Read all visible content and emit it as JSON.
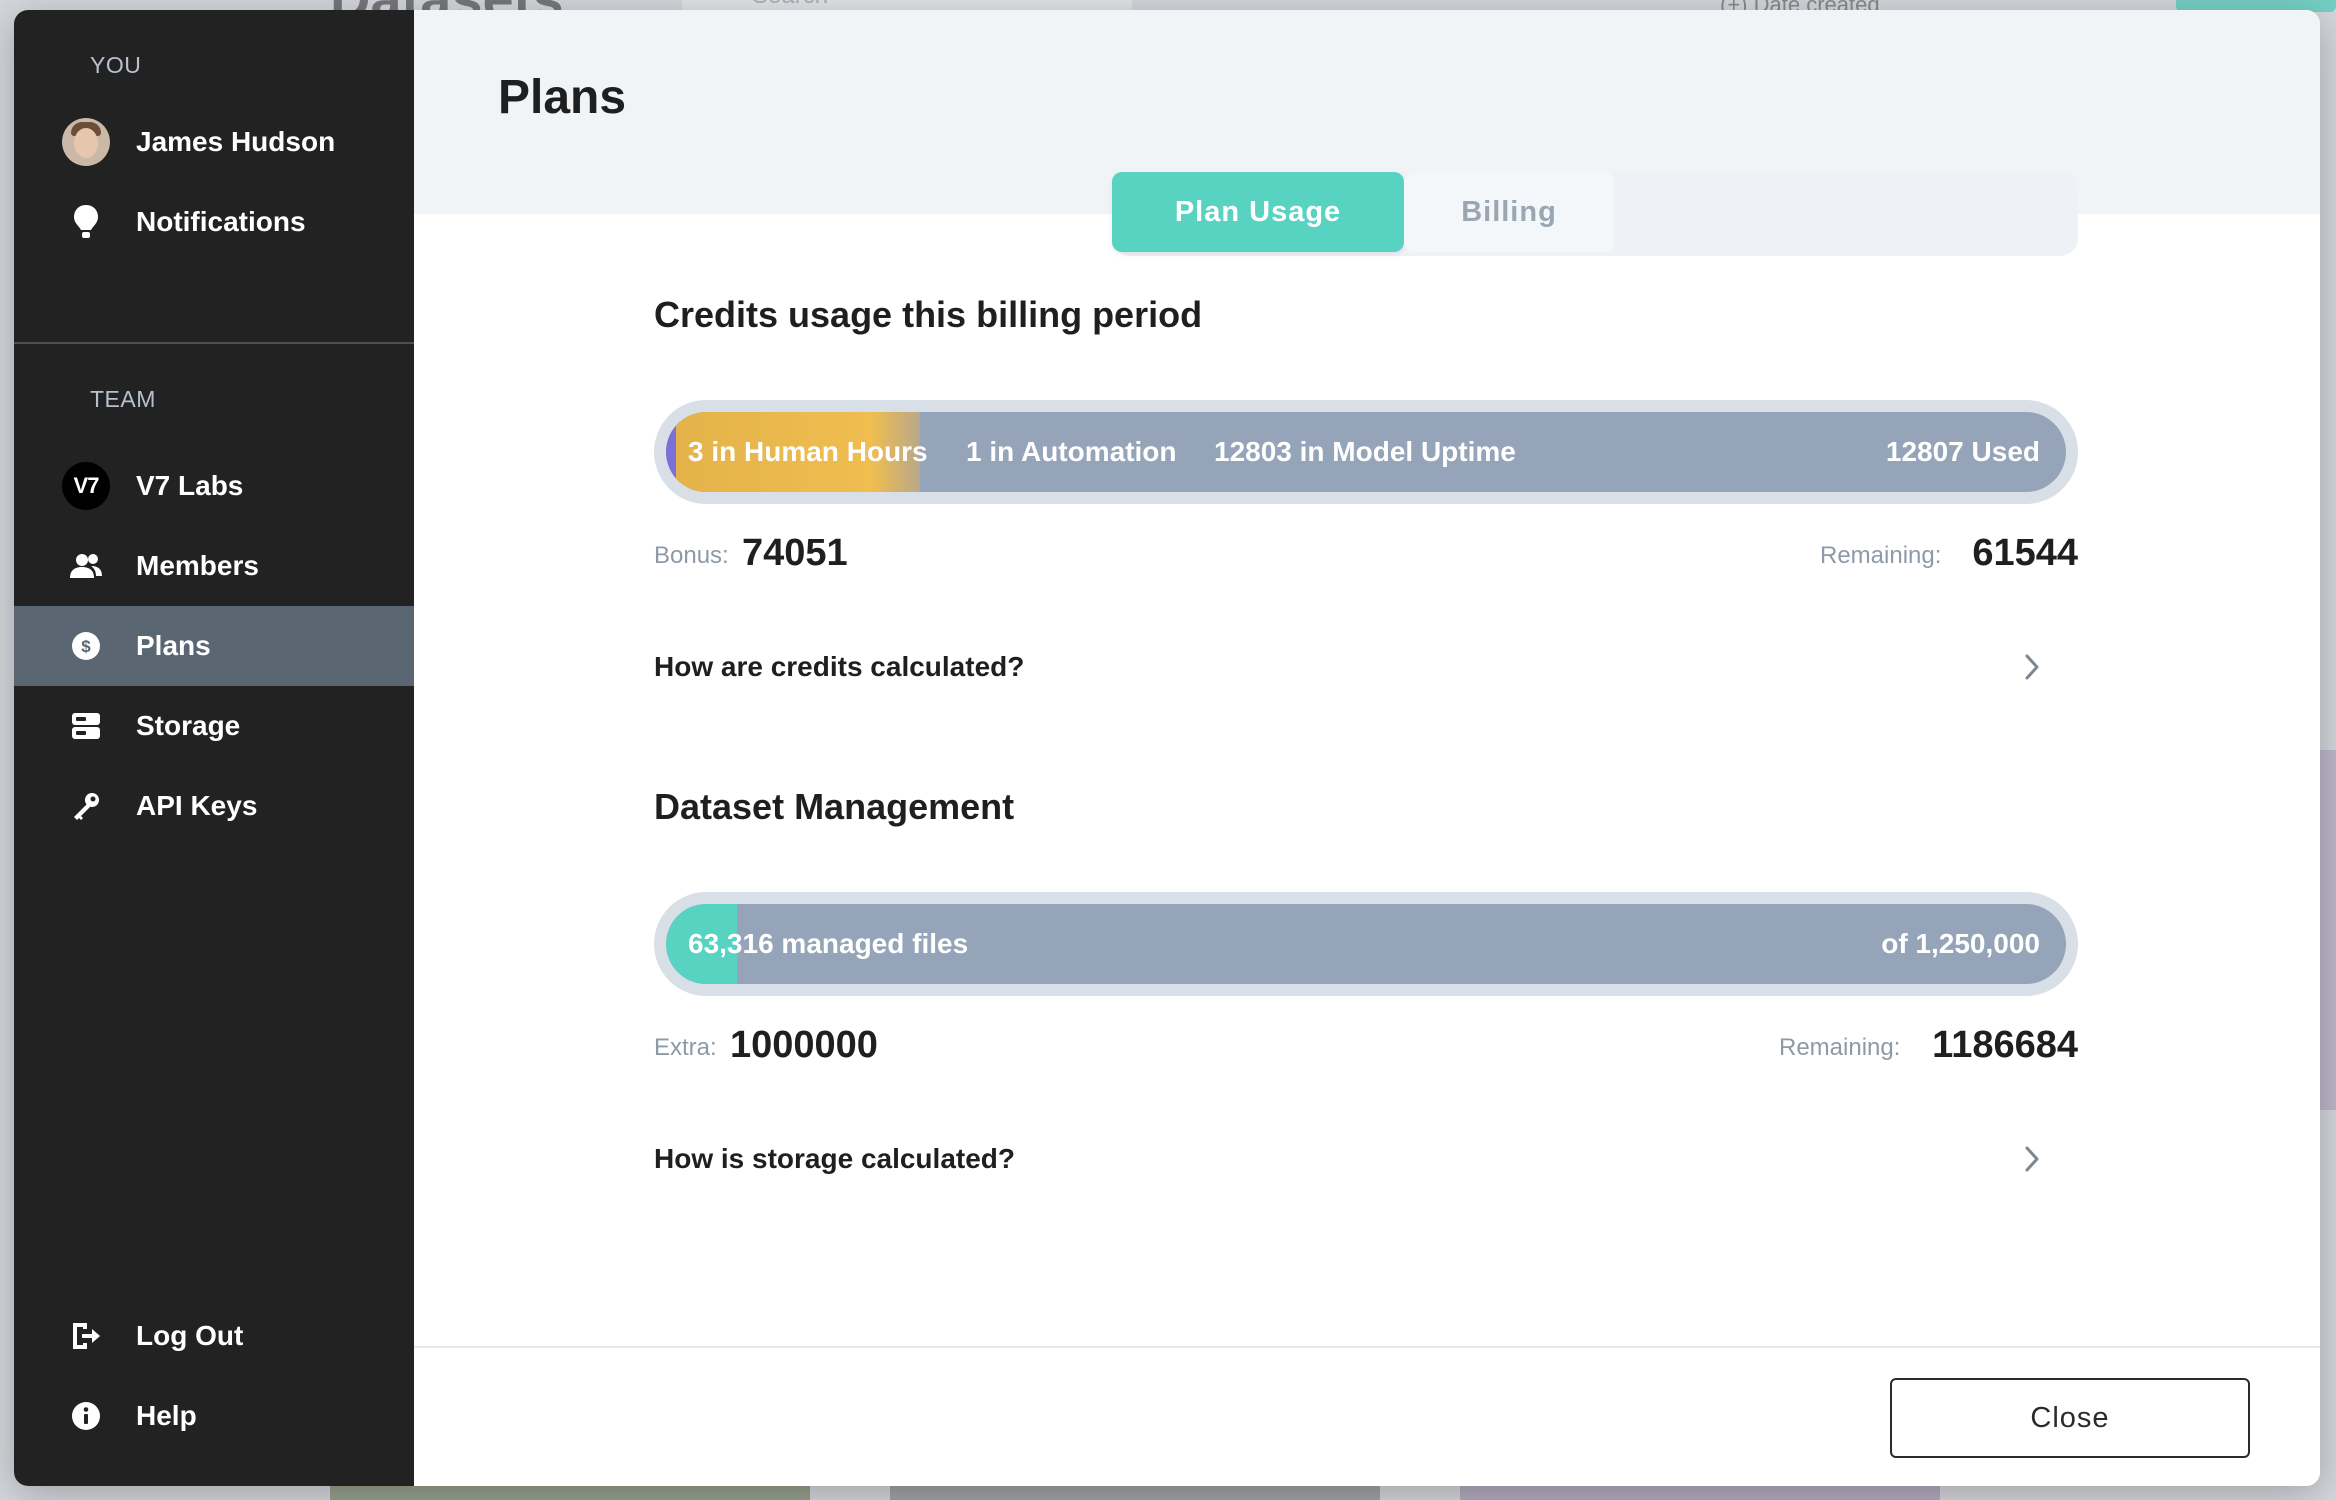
{
  "sidebar": {
    "you_label": "YOU",
    "team_label": "TEAM",
    "user": {
      "name": "James Hudson",
      "icon": "avatar"
    },
    "notifications": {
      "label": "Notifications",
      "icon": "lightbulb-icon"
    },
    "team_items": [
      {
        "label": "V7 Labs",
        "icon": "v7-logo",
        "badge_text": "V7"
      },
      {
        "label": "Members",
        "icon": "members-icon"
      },
      {
        "label": "Plans",
        "icon": "dollar-icon",
        "active": true
      },
      {
        "label": "Storage",
        "icon": "storage-icon"
      },
      {
        "label": "API Keys",
        "icon": "key-icon"
      }
    ],
    "log_out": {
      "label": "Log Out",
      "icon": "logout-icon"
    },
    "help": {
      "label": "Help",
      "icon": "info-icon"
    }
  },
  "page": {
    "title": "Plans",
    "tabs": [
      {
        "label": "Plan Usage",
        "active": true
      },
      {
        "label": "Billing",
        "active": false
      }
    ]
  },
  "credits": {
    "title": "Credits usage this billing period",
    "segments": [
      {
        "label": "3 in Human Hours",
        "color": "#e9b949"
      },
      {
        "label": "1 in Automation",
        "color": "#7b6fd8"
      },
      {
        "label": "12803 in Model Uptime",
        "color": "#95a4b8"
      }
    ],
    "used_label": "12807 Used",
    "bonus_label": "Bonus:",
    "bonus_value": "74051",
    "remaining_label": "Remaining:",
    "remaining_value": "61544",
    "help_link": "How are credits calculated?"
  },
  "storage": {
    "title": "Dataset Management",
    "managed_label": "63,316 managed files",
    "total_label": "of 1,250,000",
    "fill_fraction": 0.051,
    "extra_label": "Extra:",
    "extra_value": "1000000",
    "remaining_label": "Remaining:",
    "remaining_value": "1186684",
    "help_link": "How is storage calculated?"
  },
  "footer": {
    "close_label": "Close"
  },
  "colors": {
    "accent": "#59d3c1",
    "sidebar_bg": "#222222",
    "active_item": "#5b6673",
    "bar_bg": "#95a4b8"
  }
}
